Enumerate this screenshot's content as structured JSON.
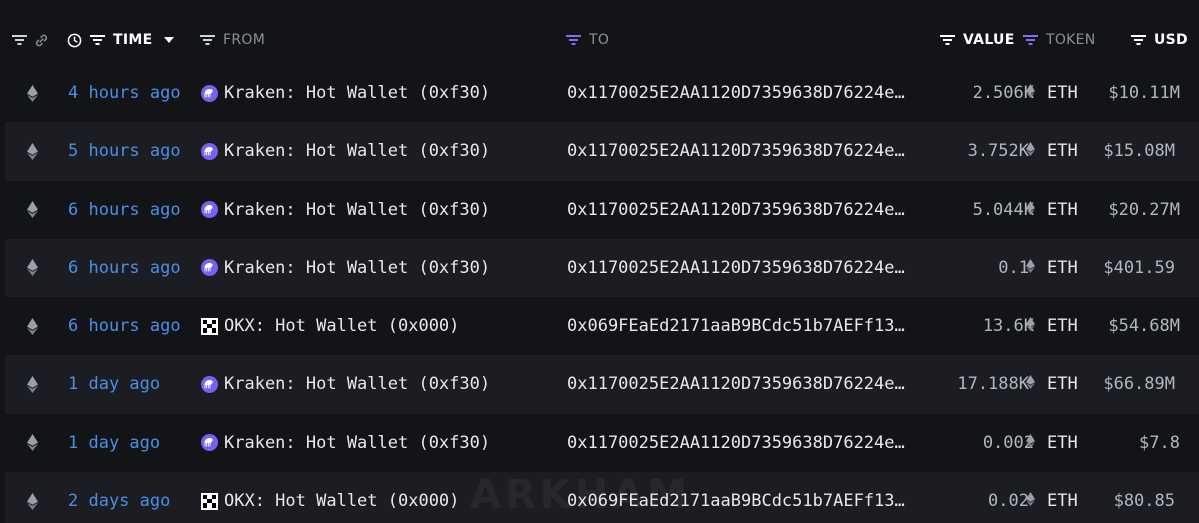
{
  "header": {
    "time_label": "TIME",
    "from_label": "FROM",
    "to_label": "TO",
    "value_label": "VALUE",
    "token_label": "TOKEN",
    "usd_label": "USD"
  },
  "colors": {
    "background": "#121418",
    "alt_row": "#1b1d23",
    "time_link": "#4a8fe7",
    "filter_active_purple": "#8b6cf0",
    "kraken_purple": "#7b5ef2"
  },
  "watermark": "ARKHAM",
  "rows": [
    {
      "chain_icon": "eth-icon",
      "time": "4 hours ago",
      "from_icon": "kraken",
      "from": "Kraken: Hot Wallet (0xf30)",
      "to": "0x1170025E2AA1120D7359638D76224e…",
      "value": "2.506K",
      "token": "ETH",
      "usd": "$10.11M"
    },
    {
      "chain_icon": "eth-icon",
      "time": "5 hours ago",
      "from_icon": "kraken",
      "from": "Kraken: Hot Wallet (0xf30)",
      "to": "0x1170025E2AA1120D7359638D76224e…",
      "value": "3.752K",
      "token": "ETH",
      "usd": "$15.08M"
    },
    {
      "chain_icon": "eth-icon",
      "time": "6 hours ago",
      "from_icon": "kraken",
      "from": "Kraken: Hot Wallet (0xf30)",
      "to": "0x1170025E2AA1120D7359638D76224e…",
      "value": "5.044K",
      "token": "ETH",
      "usd": "$20.27M"
    },
    {
      "chain_icon": "eth-icon",
      "time": "6 hours ago",
      "from_icon": "kraken",
      "from": "Kraken: Hot Wallet (0xf30)",
      "to": "0x1170025E2AA1120D7359638D76224e…",
      "value": "0.1",
      "token": "ETH",
      "usd": "$401.59"
    },
    {
      "chain_icon": "eth-icon",
      "time": "6 hours ago",
      "from_icon": "okx",
      "from": "OKX: Hot Wallet (0x000)",
      "to": "0x069FEaEd2171aaB9BCdc51b7AEFf13…",
      "value": "13.6K",
      "token": "ETH",
      "usd": "$54.68M"
    },
    {
      "chain_icon": "eth-icon",
      "time": "1 day ago",
      "from_icon": "kraken",
      "from": "Kraken: Hot Wallet (0xf30)",
      "to": "0x1170025E2AA1120D7359638D76224e…",
      "value": "17.188K",
      "token": "ETH",
      "usd": "$66.89M"
    },
    {
      "chain_icon": "eth-icon",
      "time": "1 day ago",
      "from_icon": "kraken",
      "from": "Kraken: Hot Wallet (0xf30)",
      "to": "0x1170025E2AA1120D7359638D76224e…",
      "value": "0.002",
      "token": "ETH",
      "usd": "$7.8"
    },
    {
      "chain_icon": "eth-icon",
      "time": "2 days ago",
      "from_icon": "okx",
      "from": "OKX: Hot Wallet (0x000)",
      "to": "0x069FEaEd2171aaB9BCdc51b7AEFf13…",
      "value": "0.02",
      "token": "ETH",
      "usd": "$80.85"
    }
  ]
}
